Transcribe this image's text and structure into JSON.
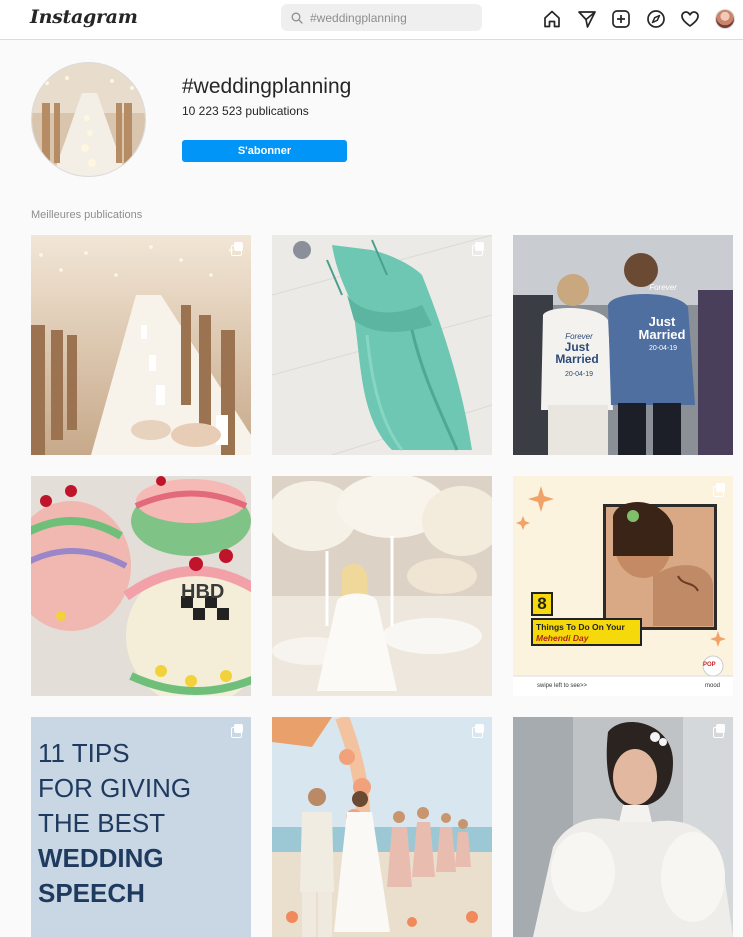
{
  "app": {
    "logo": "Instagram"
  },
  "search": {
    "placeholder": "#weddingplanning"
  },
  "nav": {
    "icons": [
      "home-icon",
      "direct-icon",
      "new-post-icon",
      "explore-icon",
      "activity-icon",
      "profile-avatar"
    ]
  },
  "hashtag": {
    "title": "#weddingplanning",
    "count": "10 223 523 publications",
    "follow_label": "S'abonner"
  },
  "top_posts": {
    "label": "Meilleures publications",
    "posts": [
      {
        "subject": "long reception table with candles"
      },
      {
        "subject": "mint green tulle dress"
      },
      {
        "subject": "couple in just married jackets",
        "jacket_left": "Just Married",
        "jacket_left_top": "Forever",
        "jacket_left_date": "20-04-19",
        "jacket_right": "Just Married",
        "jacket_right_top": "Forever",
        "jacket_right_date": "20-04-19"
      },
      {
        "subject": "colorful cakes",
        "cake_text": "HBD"
      },
      {
        "subject": "bride in white floral reception"
      },
      {
        "subject": "mehendi graphic",
        "number": "8",
        "line1": "Things To Do On Your",
        "line2": "Mehendi Day",
        "footer_left": "swipe left to see>>",
        "footer_right": "mood",
        "badge": "POP"
      },
      {
        "subject": "speech tips",
        "lines": [
          "11 TIPS",
          "FOR GIVING",
          "THE BEST",
          "WEDDING",
          "SPEECH"
        ]
      },
      {
        "subject": "beach wedding party"
      },
      {
        "subject": "bride portrait with sheer sleeves"
      }
    ]
  },
  "colors": {
    "accent": "#0095f6",
    "background": "#fafafa",
    "speech_bg": "#c9d6e3",
    "speech_text": "#1e3a5f",
    "mehendi_yellow": "#f5d90a"
  }
}
